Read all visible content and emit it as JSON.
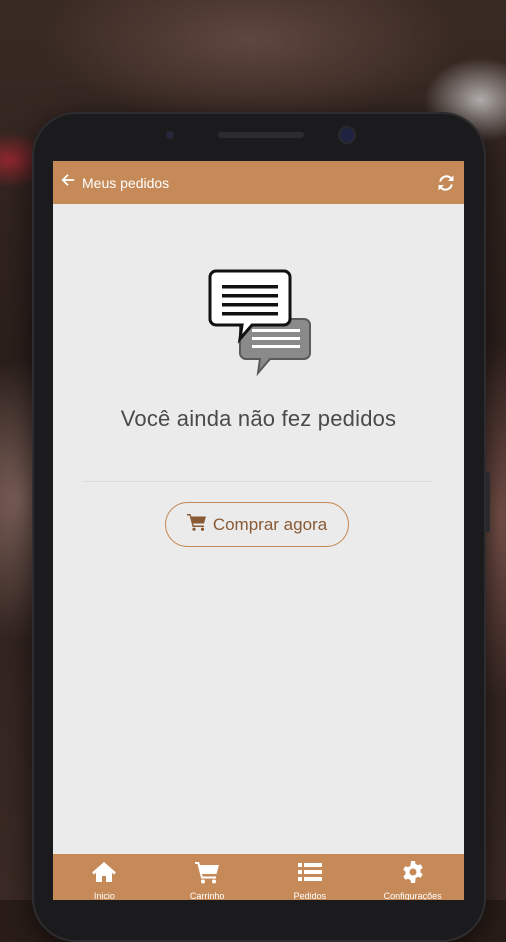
{
  "header": {
    "title": "Meus pedidos",
    "back_icon": "arrow-left-icon",
    "refresh_icon": "refresh-icon"
  },
  "empty_state": {
    "icon": "chat-bubbles-icon",
    "message": "Você ainda não fez pedidos",
    "button_label": "Comprar agora",
    "button_icon": "cart-icon"
  },
  "bottom_nav": {
    "items": [
      {
        "label": "Inicio",
        "icon": "home-icon"
      },
      {
        "label": "Carrinho",
        "icon": "cart-icon"
      },
      {
        "label": "Pedidos",
        "icon": "list-icon"
      },
      {
        "label": "Configurações",
        "icon": "gear-icon"
      }
    ]
  },
  "colors": {
    "accent": "#c58a58",
    "screen_bg": "#ebebeb",
    "text": "#4a4a4a"
  }
}
